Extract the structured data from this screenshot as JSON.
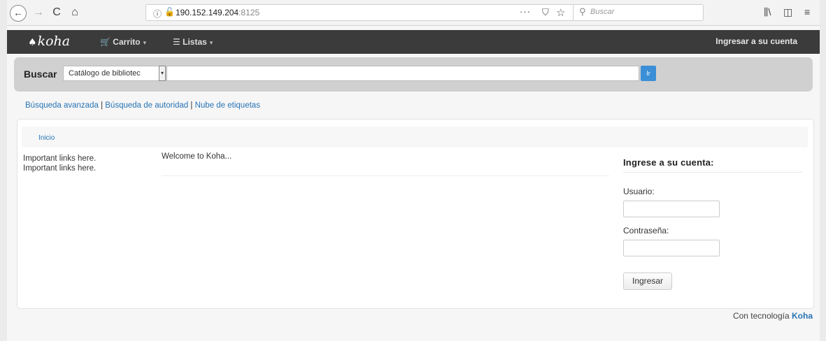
{
  "browser": {
    "back_glyph": "←",
    "forward_glyph": "→",
    "reload_glyph": "C",
    "home_glyph": "⌂",
    "info_glyph": "ⓘ",
    "lock_glyph": "🔓",
    "url_host": "190.152.149.204",
    "url_port": ":8125",
    "page_actions_glyph": "···",
    "pocket_glyph": "⛉",
    "star_glyph": "☆",
    "search_glyph": "⚲",
    "search_placeholder": "Buscar",
    "library_glyph": "⫼\\",
    "sidebar_glyph": "◫",
    "menu_glyph": "≡"
  },
  "navbar": {
    "logo_leaf": "♠",
    "logo_text": "koha",
    "cart_icon": "🛒",
    "cart_label": "Carrito",
    "lists_icon": "☰",
    "lists_label": "Listas",
    "caret": "▾",
    "login_link": "Ingresar a su cuenta"
  },
  "masthead": {
    "search_label": "Buscar",
    "catalog_selected": "Catálogo de bibliotec",
    "select_caret": "▾",
    "query_value": "",
    "go_label": "Ir"
  },
  "more_searches": {
    "advanced": "Búsqueda avanzada",
    "sep": " | ",
    "authority": "Búsqueda de autoridad",
    "tags": "Nube de etiquetas"
  },
  "breadcrumb": {
    "home": "Inicio"
  },
  "sidebar": {
    "links": [
      "Important links here.",
      "Important links here."
    ]
  },
  "main": {
    "welcome": "Welcome to Koha..."
  },
  "login": {
    "heading": "Ingrese a su cuenta:",
    "user_label": "Usuario:",
    "user_value": "",
    "pass_label": "Contraseña:",
    "pass_value": "",
    "submit_label": "Ingresar"
  },
  "footer": {
    "prefix": "Con tecnología ",
    "brand": "Koha"
  },
  "colors": {
    "navbar_bg": "#3b3b3b",
    "link_blue": "#2774b5",
    "button_blue": "#3a8fd6",
    "masthead_bg": "#d0d0d0"
  }
}
